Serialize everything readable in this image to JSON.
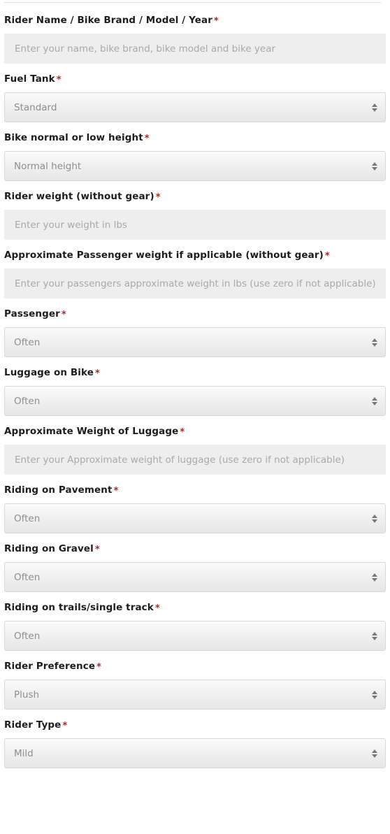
{
  "form": {
    "required_marker": "*",
    "accent_required_color": "#b3271e",
    "fields": [
      {
        "id": "rider-name-bike",
        "label": "Rider Name / Bike Brand / Model / Year",
        "required": true,
        "control": "text",
        "value": "",
        "placeholder": "Enter your name, bike brand, bike model and bike year"
      },
      {
        "id": "fuel-tank",
        "label": "Fuel Tank",
        "required": true,
        "control": "select",
        "value": "Standard"
      },
      {
        "id": "bike-height",
        "label": "Bike normal or low height",
        "required": true,
        "control": "select",
        "value": "Normal height"
      },
      {
        "id": "rider-weight",
        "label": "Rider weight (without gear)",
        "required": true,
        "control": "text",
        "value": "",
        "placeholder": "Enter your weight in lbs"
      },
      {
        "id": "passenger-weight",
        "label": "Approximate Passenger weight if applicable (without gear)",
        "required": true,
        "control": "text",
        "value": "",
        "placeholder": "Enter your passengers approximate weight in lbs (use zero if not applicable)"
      },
      {
        "id": "passenger",
        "label": "Passenger",
        "required": true,
        "control": "select",
        "value": "Often"
      },
      {
        "id": "luggage-on-bike",
        "label": "Luggage on Bike",
        "required": true,
        "control": "select",
        "value": "Often"
      },
      {
        "id": "luggage-weight",
        "label": "Approximate Weight of Luggage",
        "required": true,
        "control": "text",
        "value": "",
        "placeholder": "Enter your Approximate weight of luggage (use zero if not applicable)"
      },
      {
        "id": "riding-on-pavement",
        "label": "Riding on Pavement",
        "required": true,
        "control": "select",
        "value": "Often"
      },
      {
        "id": "riding-on-gravel",
        "label": "Riding on Gravel",
        "required": true,
        "control": "select",
        "value": "Often"
      },
      {
        "id": "riding-on-trails",
        "label": "Riding on trails/single track",
        "required": true,
        "control": "select",
        "value": "Often"
      },
      {
        "id": "rider-preference",
        "label": "Rider Preference",
        "required": true,
        "control": "select",
        "value": "Plush"
      },
      {
        "id": "rider-type",
        "label": "Rider Type",
        "required": true,
        "control": "select",
        "value": "Mild"
      }
    ]
  }
}
